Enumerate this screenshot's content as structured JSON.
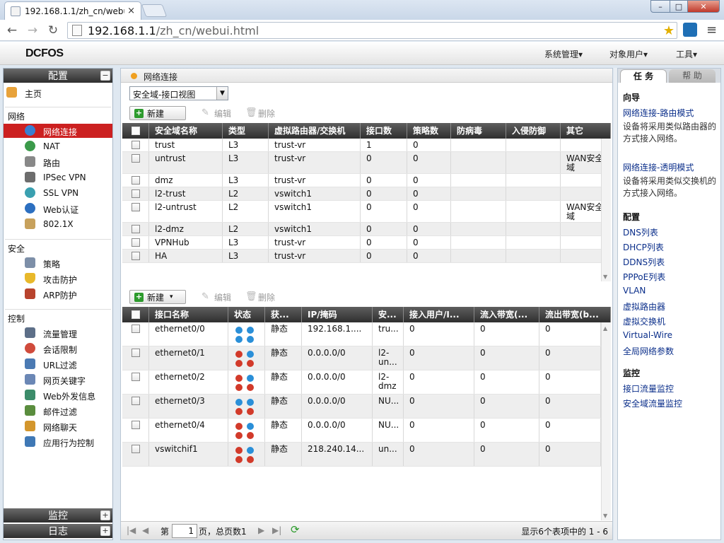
{
  "browser": {
    "tab_title": "192.168.1.1/zh_cn/webu",
    "tab_close": "×",
    "url_host": "192.168.1.1",
    "url_path": "/zh_cn/webui.html",
    "win_min": "–",
    "win_max": "□",
    "win_close": "✕",
    "back": "←",
    "forward": "→",
    "reload": "↻",
    "star": "★",
    "menu": "≡"
  },
  "app": {
    "logo": "DCFOS",
    "menus": [
      "系统管理▾",
      "对象用户▾",
      "工具▾"
    ]
  },
  "sidebar": {
    "config_header": "配置",
    "collapse": "−",
    "home": "主页",
    "section_network": "网络",
    "network_items": [
      "网络连接",
      "NAT",
      "路由",
      "IPSec VPN",
      "SSL VPN",
      "Web认证",
      "802.1X"
    ],
    "section_security": "安全",
    "security_items": [
      "策略",
      "攻击防护",
      "ARP防护"
    ],
    "section_control": "控制",
    "control_items": [
      "流量管理",
      "会话限制",
      "URL过滤",
      "网页关键字",
      "Web外发信息",
      "邮件过滤",
      "网络聊天",
      "应用行为控制"
    ],
    "monitor_header": "监控",
    "log_header": "日志",
    "expand": "+"
  },
  "main": {
    "breadcrumb": "网络连接",
    "view_select": "安全域-接口视图",
    "toolbar": {
      "new": "新建",
      "edit": "编辑",
      "delete": "删除",
      "plus": "+",
      "caret": "▾"
    },
    "zones": {
      "columns": [
        "安全域名称",
        "类型",
        "虚拟路由器/交换机",
        "接口数",
        "策略数",
        "防病毒",
        "入侵防御",
        "其它"
      ],
      "rows": [
        [
          "trust",
          "L3",
          "trust-vr",
          "1",
          "0",
          "",
          "",
          ""
        ],
        [
          "untrust",
          "L3",
          "trust-vr",
          "0",
          "0",
          "",
          "",
          "WAN安全域"
        ],
        [
          "dmz",
          "L3",
          "trust-vr",
          "0",
          "0",
          "",
          "",
          ""
        ],
        [
          "l2-trust",
          "L2",
          "vswitch1",
          "0",
          "0",
          "",
          "",
          ""
        ],
        [
          "l2-untrust",
          "L2",
          "vswitch1",
          "0",
          "0",
          "",
          "",
          "WAN安全域"
        ],
        [
          "l2-dmz",
          "L2",
          "vswitch1",
          "0",
          "0",
          "",
          "",
          ""
        ],
        [
          "VPNHub",
          "L3",
          "trust-vr",
          "0",
          "0",
          "",
          "",
          ""
        ],
        [
          "HA",
          "L3",
          "trust-vr",
          "0",
          "0",
          "",
          "",
          ""
        ]
      ]
    },
    "interfaces": {
      "columns": [
        "接口名称",
        "状态",
        "获...",
        "IP/掩码",
        "安...",
        "接入用户/I...",
        "流入带宽(...",
        "流出带宽(b..."
      ],
      "rows": [
        [
          "ethernet0/0",
          "静态",
          "192.168.1....",
          "tru...",
          "0",
          "0",
          "0"
        ],
        [
          "ethernet0/1",
          "静态",
          "0.0.0.0/0",
          "l2-un...",
          "0",
          "0",
          "0"
        ],
        [
          "ethernet0/2",
          "静态",
          "0.0.0.0/0",
          "l2-dmz",
          "0",
          "0",
          "0"
        ],
        [
          "ethernet0/3",
          "静态",
          "0.0.0.0/0",
          "NU...",
          "0",
          "0",
          "0"
        ],
        [
          "ethernet0/4",
          "静态",
          "0.0.0.0/0",
          "NU...",
          "0",
          "0",
          "0"
        ],
        [
          "vswitchif1",
          "静态",
          "218.240.14...",
          "un...",
          "0",
          "0",
          "0"
        ]
      ]
    },
    "pager": {
      "page_prefix": "第",
      "page_value": "1",
      "page_suffix": "页，总页数1",
      "summary": "显示6个表项中的 1 - 6",
      "first": "|◀",
      "prev": "◀",
      "next": "▶",
      "last": "▶|",
      "refresh": "⟳"
    }
  },
  "rightpanel": {
    "tab_tasks": "任 务",
    "tab_help": "帮 助",
    "wizard_title": "向导",
    "wizard_link1": "网络连接-路由模式",
    "wizard_desc1": "设备将采用类似路由器的方式接入网络。",
    "wizard_link2": "网络连接-透明模式",
    "wizard_desc2": "设备将采用类似交换机的方式接入网络。",
    "config_title": "配置",
    "config_links": [
      "DNS列表",
      "DHCP列表",
      "DDNS列表",
      "PPPoE列表",
      "VLAN",
      "虚拟路由器",
      "虚拟交换机",
      "Virtual-Wire",
      "全局网络参数"
    ],
    "monitor_title": "监控",
    "monitor_links": [
      "接口流量监控",
      "安全域流量监控"
    ]
  },
  "colors": {
    "selected": "#cc2020",
    "header": "#3a3a3a",
    "link": "#0a2e8a",
    "status_ok": "#2a8fd8",
    "status_down": "#d23a2a"
  }
}
